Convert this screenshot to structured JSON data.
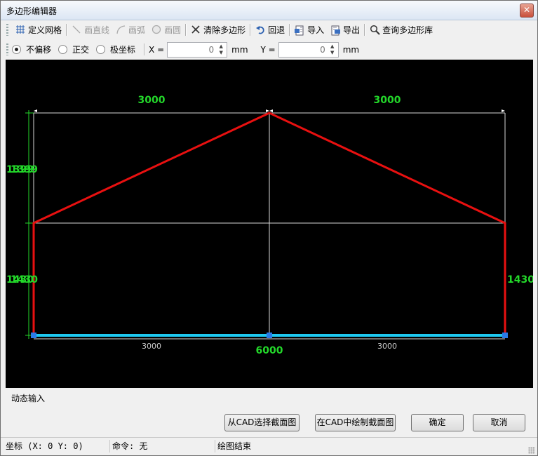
{
  "window": {
    "title": "多边形编辑器",
    "close_glyph": "✕"
  },
  "toolbar1": {
    "define_grid": "定义网格",
    "draw_line": "画直线",
    "draw_arc": "画弧",
    "draw_circle": "画圆",
    "clear_polygon": "清除多边形",
    "undo": "回退",
    "import": "导入",
    "export": "导出",
    "query_library": "查询多边形库"
  },
  "toolbar2": {
    "radio_no_offset": "不偏移",
    "radio_ortho": "正交",
    "radio_polar": "极坐标",
    "x_label": "X =",
    "x_value": "0",
    "x_unit": "mm",
    "y_label": "Y =",
    "y_value": "0",
    "y_unit": "mm"
  },
  "canvas": {
    "dim_top_left": "3000",
    "dim_top_right": "3000",
    "dim_left_upper": "1399",
    "dim_left_upper_overlap": "1399",
    "dim_left_lower": "1430",
    "dim_left_lower_overlap": "1430",
    "dim_right_lower": "1430",
    "dim_bottom_left": "3000",
    "dim_bottom_right": "3000",
    "dim_bottom_total": "6000",
    "colors": {
      "polygon": "#e81010",
      "dimension": "#23d82a",
      "base": "#1ec8f0",
      "grid": "#d8d8d8",
      "node": "#2a7be8"
    }
  },
  "dynamic_input": {
    "label": "动态输入"
  },
  "buttons": {
    "select_from_cad": "从CAD选择截面图",
    "draw_in_cad": "在CAD中绘制截面图",
    "ok": "确定",
    "cancel": "取消"
  },
  "status": {
    "coords": "坐标 (X: 0 Y: 0)",
    "command": "命令: 无",
    "message": "绘图结束"
  }
}
